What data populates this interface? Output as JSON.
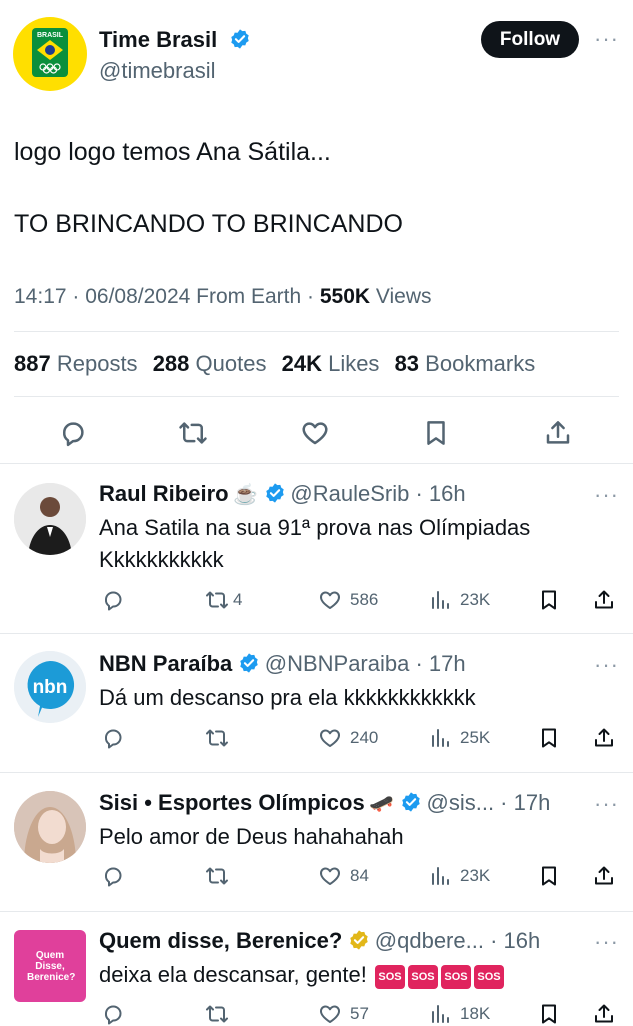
{
  "post": {
    "author_name": "Time Brasil",
    "author_handle": "@timebrasil",
    "avatar_text": "BRASIL",
    "follow_label": "Follow",
    "more_label": "···",
    "line1": "logo logo temos Ana Sátila...",
    "line2": "TO BRINCANDO TO BRINCANDO",
    "meta_time": "14:17 · 06/08/2024 From Earth ·",
    "meta_views_count": "550K",
    "meta_views_label": "Views",
    "stats": {
      "reposts_count": "887",
      "reposts_label": "Reposts",
      "quotes_count": "288",
      "quotes_label": "Quotes",
      "likes_count": "24K",
      "likes_label": "Likes",
      "bookmarks_count": "83",
      "bookmarks_label": "Bookmarks"
    }
  },
  "replies": [
    {
      "name": "Raul Ribeiro",
      "name_emoji": "☕",
      "handle_time": "@RauleSrib · 16h",
      "text1": "Ana Satila na sua 91ª prova nas Olímpiadas",
      "text2": "Kkkkkkkkkkk",
      "reposts": "4",
      "likes": "586",
      "views": "23K"
    },
    {
      "name": "NBN Paraíba",
      "handle_time": "@NBNParaiba · 17h",
      "avatar_text": "nbn",
      "text1": "Dá um descanso pra ela kkkkkkkkkkkk",
      "reposts": "",
      "likes": "240",
      "views": "25K"
    },
    {
      "name": "Sisi • Esportes Olímpicos",
      "name_emoji": "🛹",
      "handle_time": "@sis... · 17h",
      "text1": "Pelo amor de Deus hahahahah",
      "reposts": "",
      "likes": "84",
      "views": "23K"
    },
    {
      "name": "Quem disse, Berenice?",
      "handle_time": "@qdbere... · 16h",
      "avatar_text": "Quem Disse, Berenice?",
      "text1": "deixa ela descansar, gente!",
      "sos_labels": [
        "SOS",
        "SOS",
        "SOS",
        "SOS"
      ],
      "reposts": "",
      "likes": "57",
      "views": "18K"
    }
  ],
  "colors": {
    "verified_blue": "#1d9bf0",
    "verified_gold": "#e2b719",
    "follow_bg": "#0f1419",
    "avatar_yellow": "#ffdf00",
    "nbn_blue": "#1c9bd7",
    "berenice_pink": "#e0409b",
    "sos_red": "#e0245e"
  }
}
